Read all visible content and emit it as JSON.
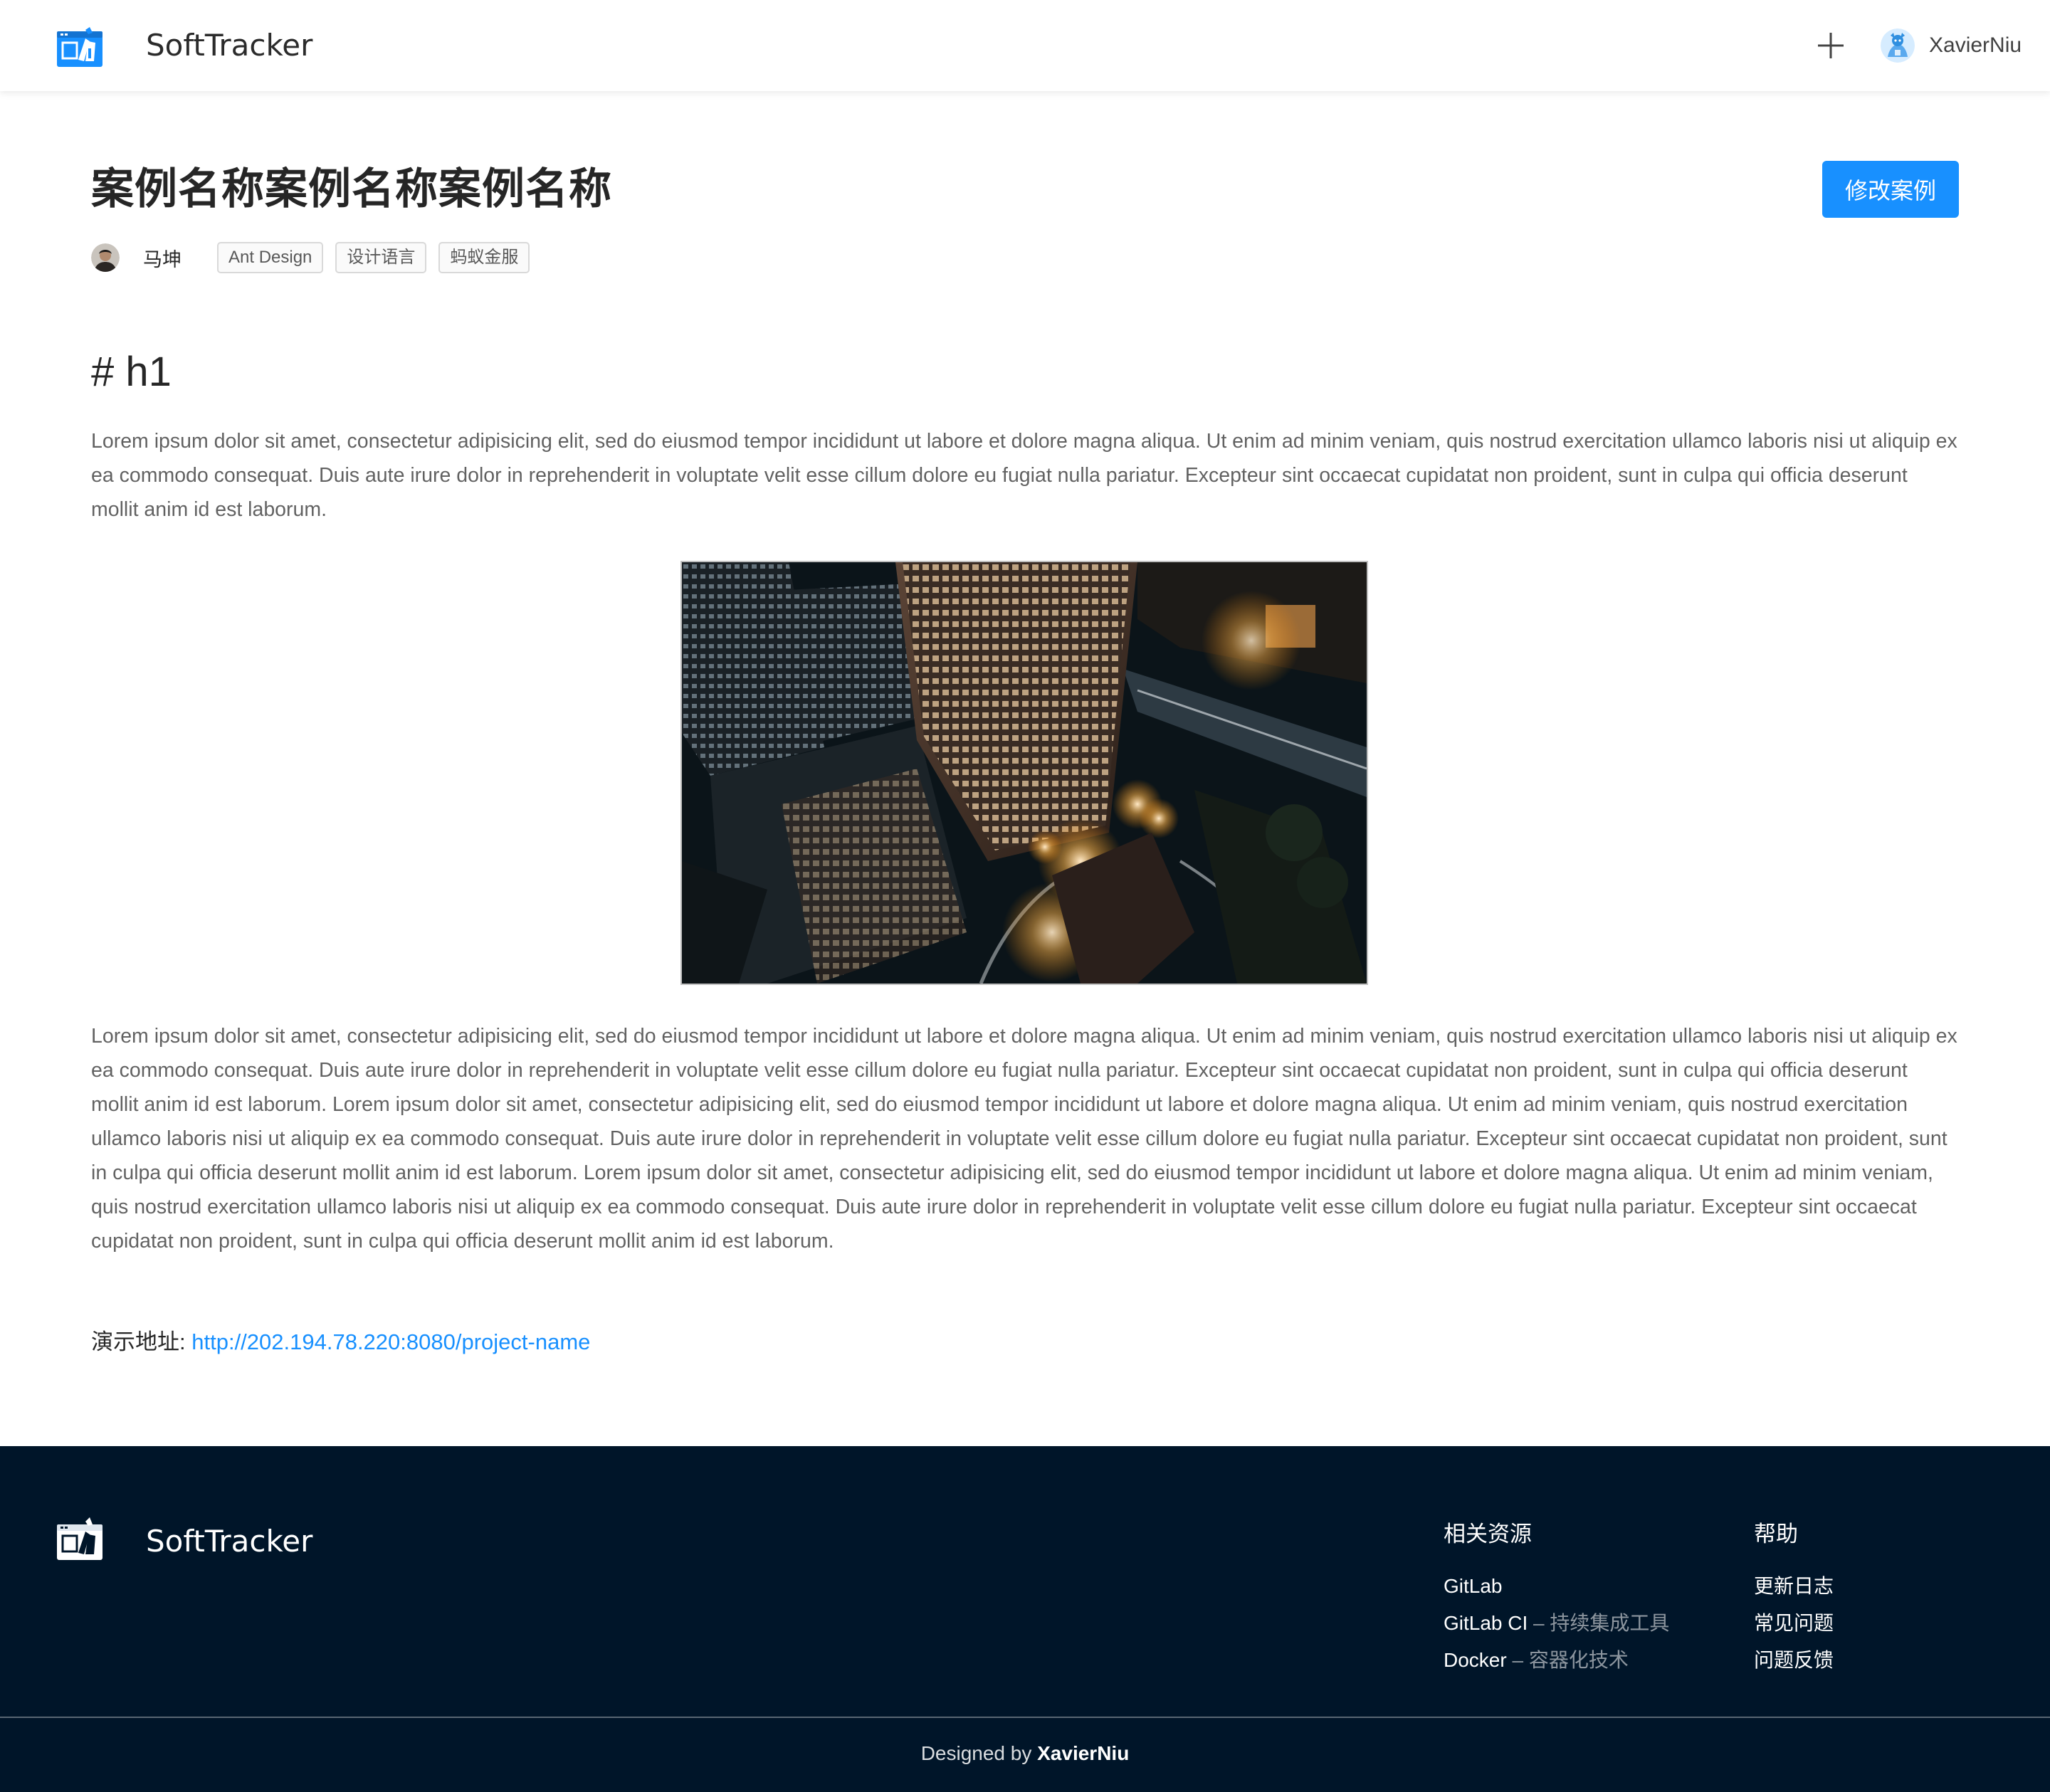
{
  "header": {
    "brand": "SoftTracker",
    "username": "XavierNiu"
  },
  "case": {
    "title": "案例名称案例名称案例名称",
    "edit_label": "修改案例",
    "author": "马坤",
    "tags": [
      "Ant Design",
      "设计语言",
      "蚂蚁金服"
    ]
  },
  "article": {
    "heading": "# h1",
    "paragraph1": "Lorem ipsum dolor sit amet, consectetur adipisicing elit, sed do eiusmod tempor incididunt ut labore et dolore magna aliqua. Ut enim ad minim veniam, quis nostrud exercitation ullamco laboris nisi ut aliquip ex ea commodo consequat. Duis aute irure dolor in reprehenderit in voluptate velit esse cillum dolore eu fugiat nulla pariatur. Excepteur sint occaecat cupidatat non proident, sunt in culpa qui officia deserunt mollit anim id est laborum.",
    "paragraph2": "Lorem ipsum dolor sit amet, consectetur adipisicing elit, sed do eiusmod tempor incididunt ut labore et dolore magna aliqua. Ut enim ad minim veniam, quis nostrud exercitation ullamco laboris nisi ut aliquip ex ea commodo consequat. Duis aute irure dolor in reprehenderit in voluptate velit esse cillum dolore eu fugiat nulla pariatur. Excepteur sint occaecat cupidatat non proident, sunt in culpa qui officia deserunt mollit anim id est laborum. Lorem ipsum dolor sit amet, consectetur adipisicing elit, sed do eiusmod tempor incididunt ut labore et dolore magna aliqua. Ut enim ad minim veniam, quis nostrud exercitation ullamco laboris nisi ut aliquip ex ea commodo consequat. Duis aute irure dolor in reprehenderit in voluptate velit esse cillum dolore eu fugiat nulla pariatur. Excepteur sint occaecat cupidatat non proident, sunt in culpa qui officia deserunt mollit anim id est laborum. Lorem ipsum dolor sit amet, consectetur adipisicing elit, sed do eiusmod tempor incididunt ut labore et dolore magna aliqua. Ut enim ad minim veniam, quis nostrud exercitation ullamco laboris nisi ut aliquip ex ea commodo consequat. Duis aute irure dolor in reprehenderit in voluptate velit esse cillum dolore eu fugiat nulla pariatur. Excepteur sint occaecat cupidatat non proident, sunt in culpa qui officia deserunt mollit anim id est laborum.",
    "demo_label": "演示地址:",
    "demo_url": "http://202.194.78.220:8080/project-name"
  },
  "footer": {
    "brand": "SoftTracker",
    "resources": {
      "title": "相关资源",
      "items": [
        {
          "name": "GitLab",
          "desc": ""
        },
        {
          "name": "GitLab CI",
          "desc": " – 持续集成工具"
        },
        {
          "name": "Docker",
          "desc": " – 容器化技术"
        }
      ]
    },
    "help": {
      "title": "帮助",
      "items": [
        "更新日志",
        "常见问题",
        "问题反馈"
      ]
    },
    "designed_by_prefix": "Designed by ",
    "designed_by_name": "XavierNiu"
  },
  "colors": {
    "primary": "#1890ff",
    "footer_bg": "#001529"
  },
  "icons": {
    "logo": "softtracker-logo-icon",
    "add": "plus-icon",
    "user_avatar": "user-avatar-icon"
  }
}
